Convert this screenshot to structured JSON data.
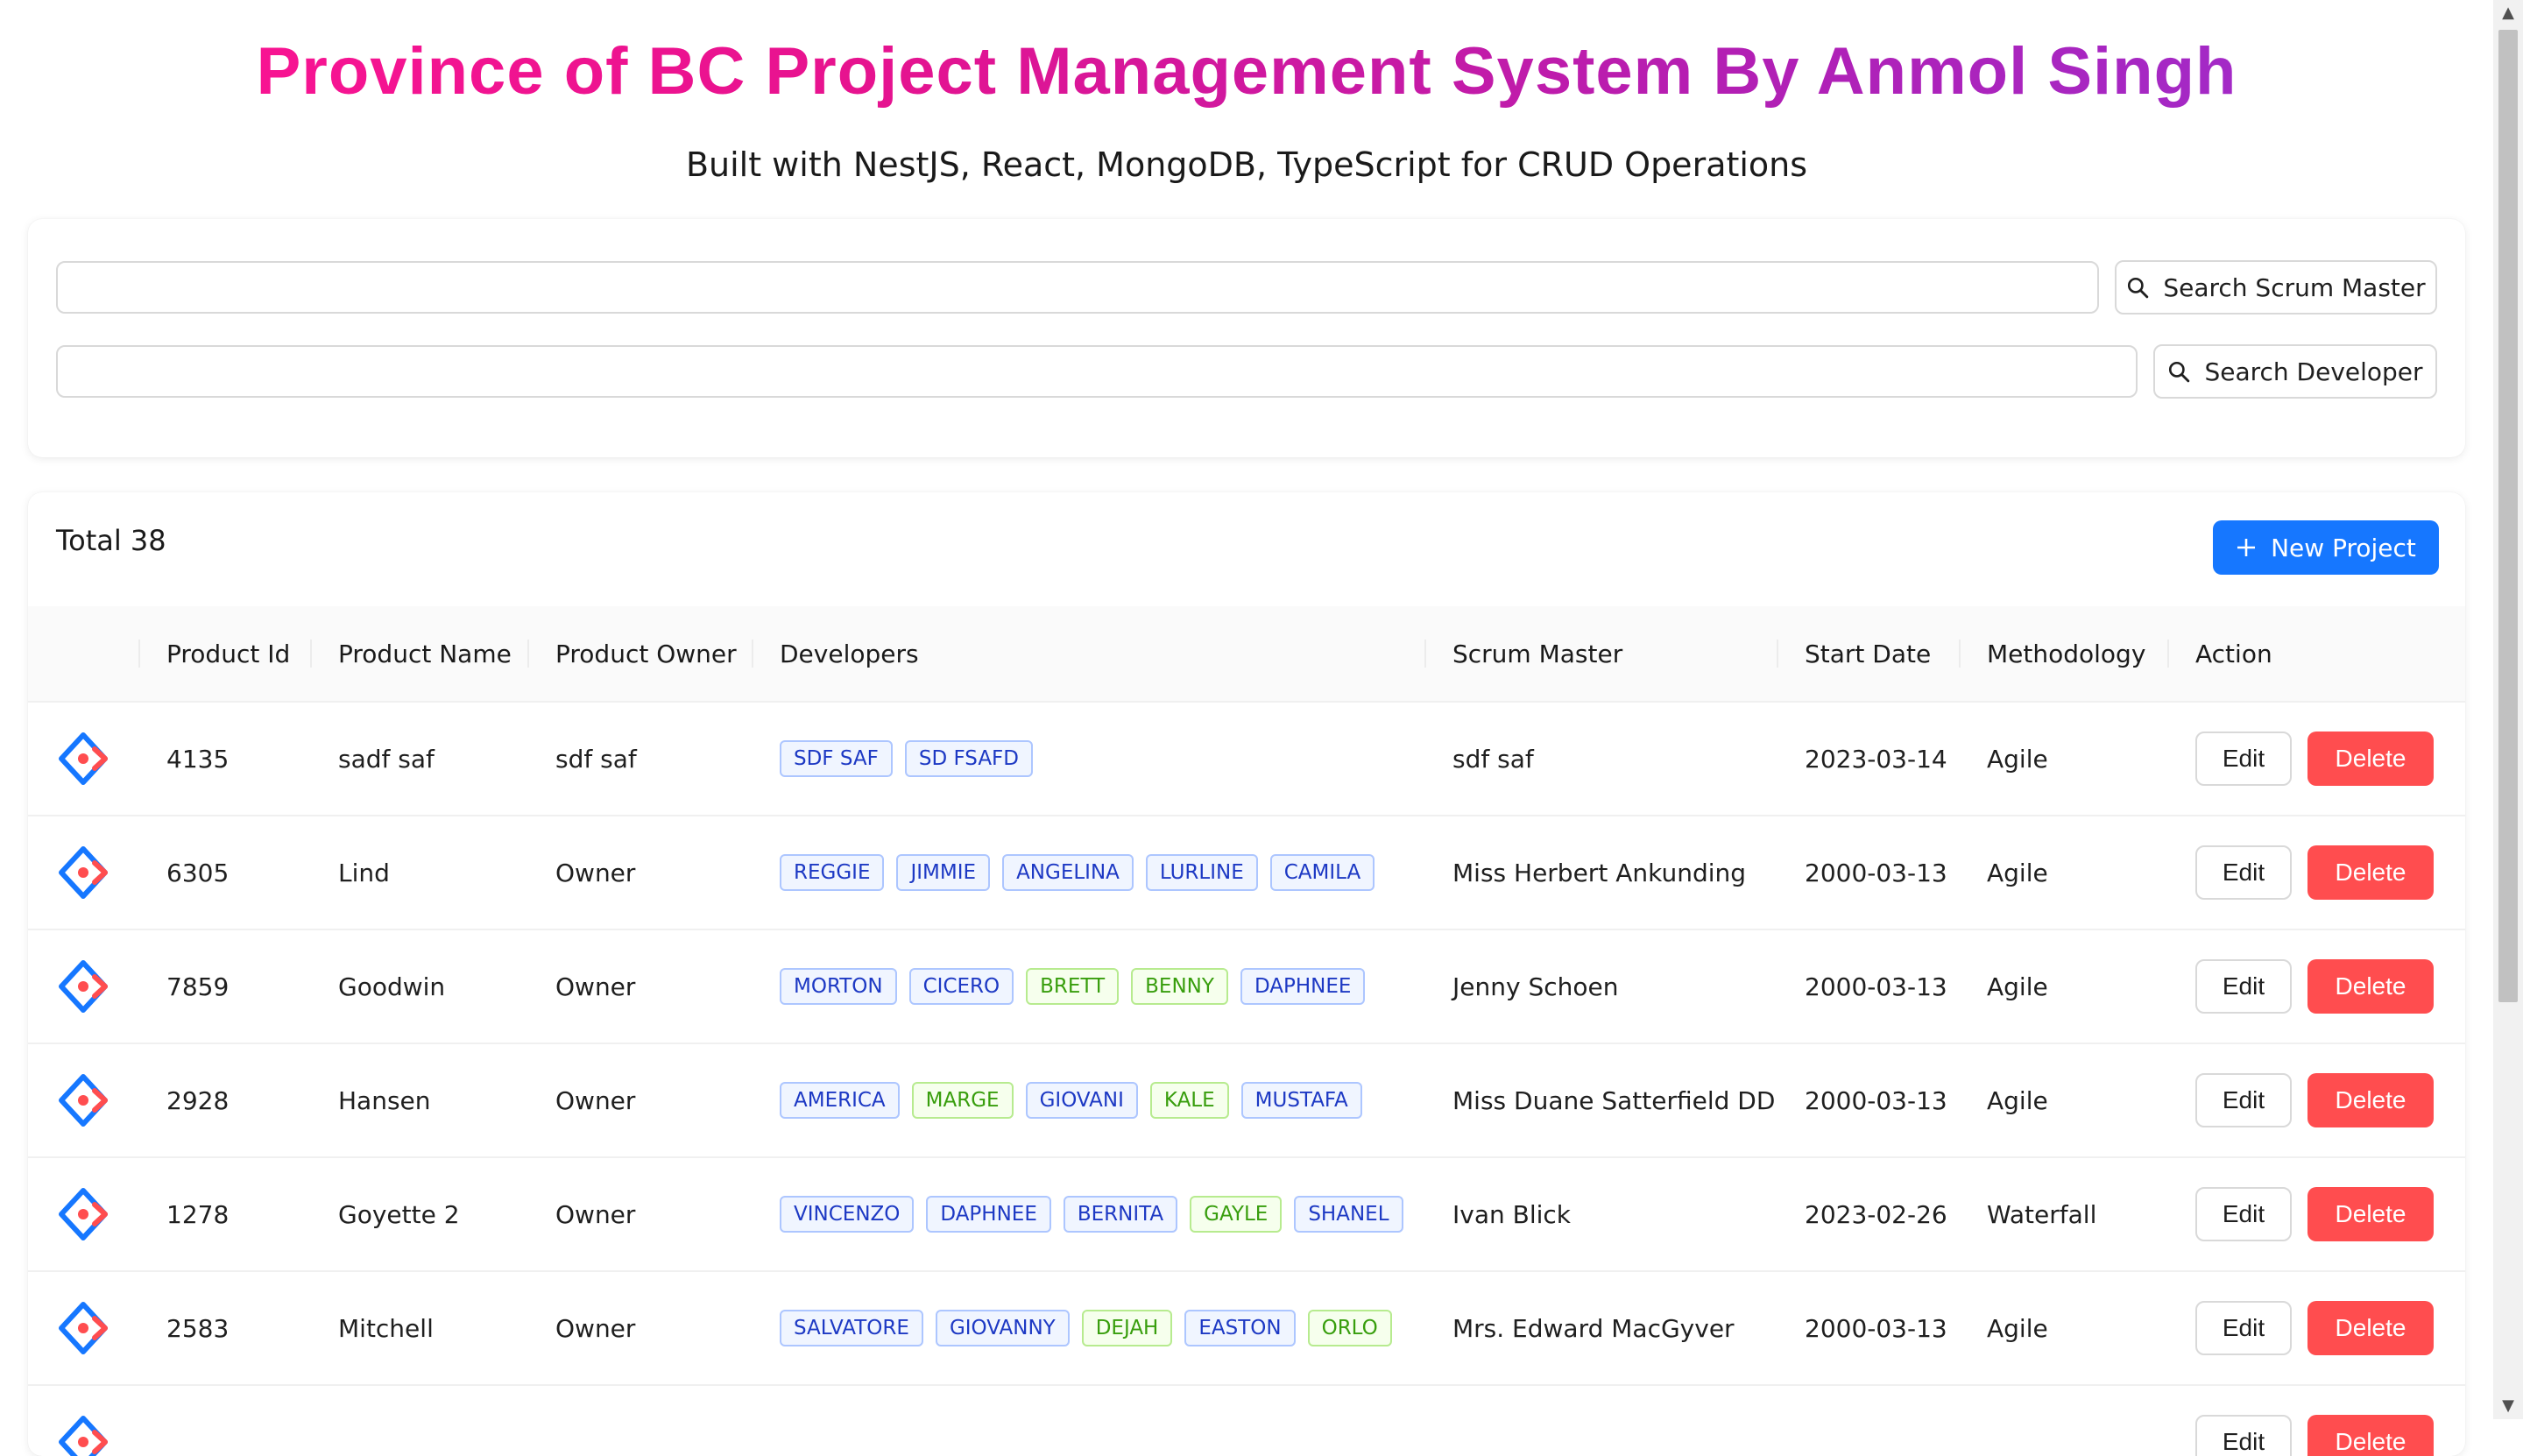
{
  "header": {
    "title": "Province of BC Project Management System By Anmol Singh",
    "subtitle": "Built with NestJS, React, MongoDB, TypeScript for CRUD Operations"
  },
  "search": {
    "scrum_value": "",
    "scrum_button": "Search Scrum Master",
    "developer_value": "",
    "developer_button": "Search Developer"
  },
  "table": {
    "total_label": "Total 38",
    "new_button": "New Project",
    "columns": [
      "",
      "Product Id",
      "Product Name",
      "Product Owner",
      "Developers",
      "Scrum Master",
      "Start Date",
      "Methodology",
      "Action"
    ],
    "edit_label": "Edit",
    "delete_label": "Delete",
    "rows": [
      {
        "id": "4135",
        "name": "sadf saf",
        "owner": "sdf saf",
        "developers": [
          {
            "name": "SDF SAF",
            "color": "blue"
          },
          {
            "name": "SD FSAFD",
            "color": "blue"
          }
        ],
        "scrum": "sdf saf",
        "date": "2023-03-14",
        "method": "Agile"
      },
      {
        "id": "6305",
        "name": "Lind",
        "owner": "Owner",
        "developers": [
          {
            "name": "REGGIE",
            "color": "blue"
          },
          {
            "name": "JIMMIE",
            "color": "blue"
          },
          {
            "name": "ANGELINA",
            "color": "blue"
          },
          {
            "name": "LURLINE",
            "color": "blue"
          },
          {
            "name": "CAMILA",
            "color": "blue"
          }
        ],
        "scrum": "Miss Herbert Ankunding",
        "date": "2000-03-13",
        "method": "Agile"
      },
      {
        "id": "7859",
        "name": "Goodwin",
        "owner": "Owner",
        "developers": [
          {
            "name": "MORTON",
            "color": "blue"
          },
          {
            "name": "CICERO",
            "color": "blue"
          },
          {
            "name": "BRETT",
            "color": "green"
          },
          {
            "name": "BENNY",
            "color": "green"
          },
          {
            "name": "DAPHNEE",
            "color": "blue"
          }
        ],
        "scrum": "Jenny Schoen",
        "date": "2000-03-13",
        "method": "Agile"
      },
      {
        "id": "2928",
        "name": "Hansen",
        "owner": "Owner",
        "developers": [
          {
            "name": "AMERICA",
            "color": "blue"
          },
          {
            "name": "MARGE",
            "color": "green"
          },
          {
            "name": "GIOVANI",
            "color": "blue"
          },
          {
            "name": "KALE",
            "color": "green"
          },
          {
            "name": "MUSTAFA",
            "color": "blue"
          }
        ],
        "scrum": "Miss Duane Satterfield DDS",
        "date": "2000-03-13",
        "method": "Agile"
      },
      {
        "id": "1278",
        "name": "Goyette 2",
        "owner": "Owner",
        "developers": [
          {
            "name": "VINCENZO",
            "color": "blue"
          },
          {
            "name": "DAPHNEE",
            "color": "blue"
          },
          {
            "name": "BERNITA",
            "color": "blue"
          },
          {
            "name": "GAYLE",
            "color": "green"
          },
          {
            "name": "SHANEL",
            "color": "blue"
          }
        ],
        "scrum": "Ivan Blick",
        "date": "2023-02-26",
        "method": "Waterfall"
      },
      {
        "id": "2583",
        "name": "Mitchell",
        "owner": "Owner",
        "developers": [
          {
            "name": "SALVATORE",
            "color": "blue"
          },
          {
            "name": "GIOVANNY",
            "color": "blue"
          },
          {
            "name": "DEJAH",
            "color": "green"
          },
          {
            "name": "EASTON",
            "color": "blue"
          },
          {
            "name": "ORLO",
            "color": "green"
          }
        ],
        "scrum": "Mrs. Edward MacGyver",
        "date": "2000-03-13",
        "method": "Agile"
      },
      {
        "id": "",
        "name": "",
        "owner": "",
        "developers": [],
        "scrum": "",
        "date": "",
        "method": ""
      }
    ]
  },
  "icons": {
    "search": "search-icon",
    "plus": "plus-icon",
    "row_logo": "project-logo-icon"
  },
  "colors": {
    "primary": "#1677ff",
    "danger": "#ff4d4f",
    "title_gradient_start": "#ff1493",
    "title_gradient_end": "#9c2fd0"
  }
}
